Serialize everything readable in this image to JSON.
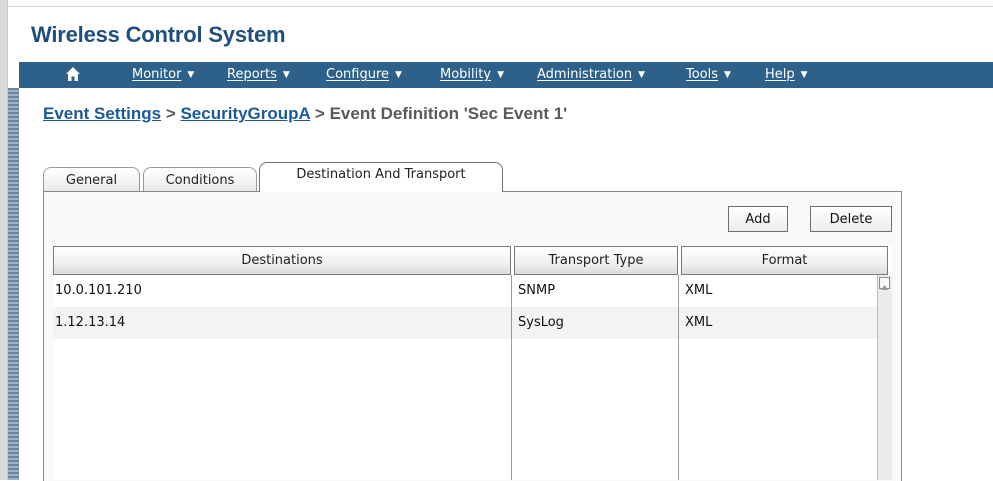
{
  "app": {
    "title": "Wireless Control System"
  },
  "nav": {
    "items": [
      {
        "label": "Monitor"
      },
      {
        "label": "Reports"
      },
      {
        "label": "Configure"
      },
      {
        "label": "Mobility"
      },
      {
        "label": "Administration"
      },
      {
        "label": "Tools"
      },
      {
        "label": "Help"
      }
    ]
  },
  "breadcrumb": {
    "crumb1": "Event Settings",
    "sep1": " > ",
    "crumb2": "SecurityGroupA",
    "sep2": " > ",
    "current": "Event Definition 'Sec Event 1'"
  },
  "tabs": [
    {
      "label": "General"
    },
    {
      "label": "Conditions"
    },
    {
      "label": "Destination And Transport"
    }
  ],
  "actions": {
    "add": "Add",
    "delete": "Delete"
  },
  "table": {
    "columns": [
      "Destinations",
      "Transport Type",
      "Format"
    ],
    "rows": [
      [
        "10.0.101.210",
        "SNMP",
        "XML"
      ],
      [
        "1.12.13.14",
        "SysLog",
        "XML"
      ]
    ]
  }
}
